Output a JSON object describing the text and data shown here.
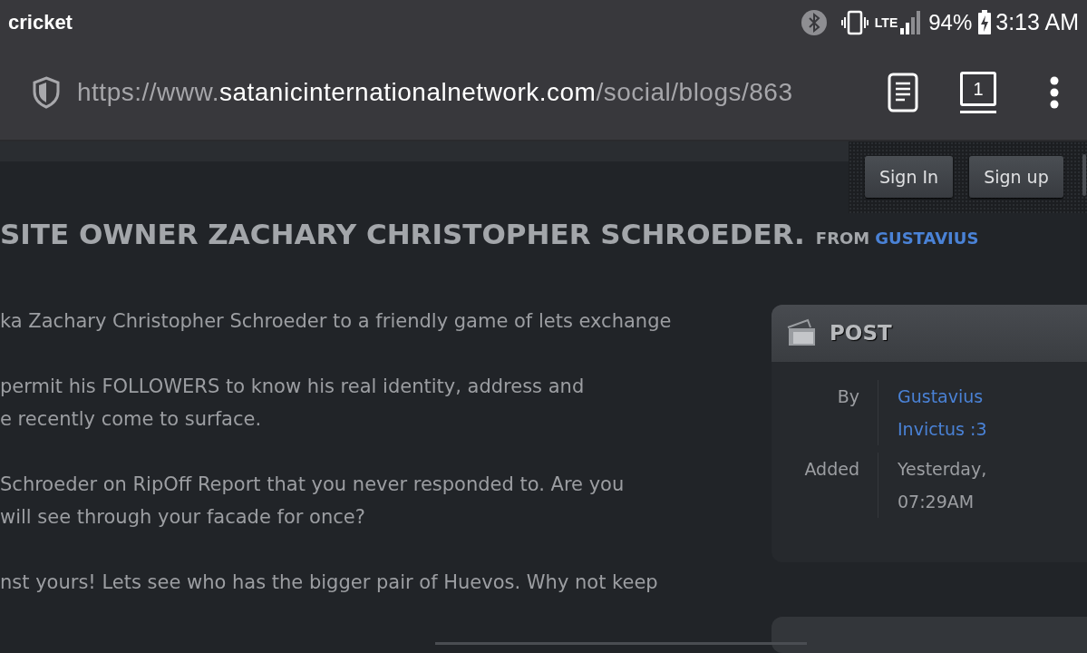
{
  "status_bar": {
    "carrier": "cricket",
    "network": "LTE",
    "battery": "94%",
    "time": "3:13 AM"
  },
  "address_bar": {
    "url_prefix": "https://www.",
    "domain": "satanicinternationalnetwork.com",
    "path": "/social/blogs/863",
    "tab_count": "1"
  },
  "header_buttons": [
    "Sign In",
    "Sign up"
  ],
  "post": {
    "title": "SITE OWNER ZACHARY CHRISTOPHER SCHROEDER.",
    "from_label": "FROM",
    "author": "GUSTAVIUS",
    "paragraphs": [
      [
        "ka Zachary Christopher Schroeder to a friendly game of lets exchange"
      ],
      [
        "permit his FOLLOWERS to know his real identity, address and",
        "e recently come to surface."
      ],
      [
        "Schroeder on RipOff Report that you never responded to. Are you",
        "will see through your facade for once?"
      ],
      [
        "nst yours! Lets see who has the bigger pair of Huevos. Why not keep"
      ]
    ]
  },
  "info_card": {
    "title": "POST",
    "rows": [
      {
        "label": "By",
        "kind": "link",
        "value_lines": [
          "Gustavius",
          "Invictus :3"
        ]
      },
      {
        "label": "Added",
        "kind": "text",
        "value_lines": [
          "Yesterday,",
          "07:29AM"
        ]
      }
    ]
  }
}
